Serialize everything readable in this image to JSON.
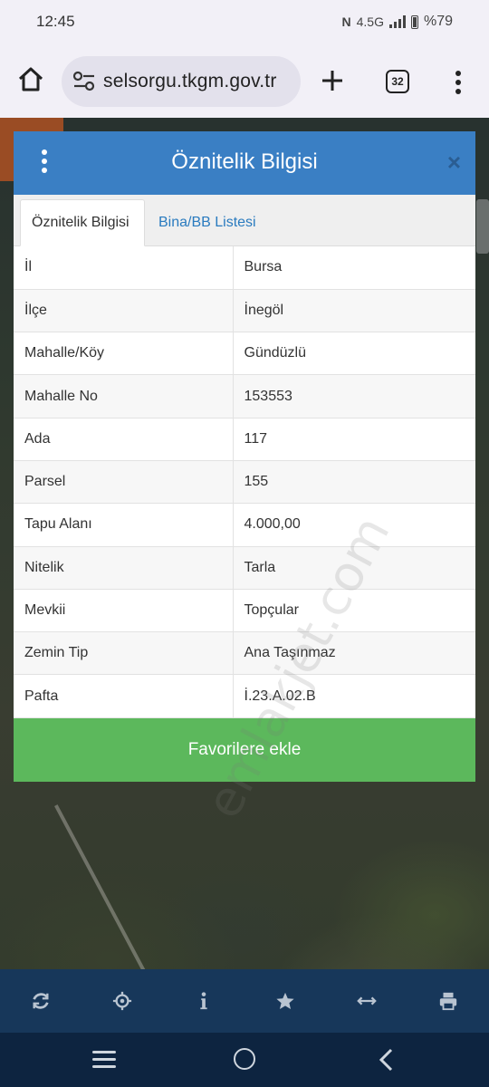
{
  "status_bar": {
    "time": "12:45",
    "network": "4.5G",
    "battery": "%79"
  },
  "browser": {
    "url": "selsorgu.tkgm.gov.tr",
    "tab_count": "32"
  },
  "dialog": {
    "title": "Öznitelik Bilgisi",
    "close_label": "×",
    "tabs": [
      {
        "label": "Öznitelik Bilgisi",
        "active": true
      },
      {
        "label": "Bina/BB Listesi",
        "active": false
      }
    ],
    "rows": [
      {
        "key": "İl",
        "value": "Bursa"
      },
      {
        "key": "İlçe",
        "value": "İnegöl"
      },
      {
        "key": "Mahalle/Köy",
        "value": "Gündüzlü"
      },
      {
        "key": "Mahalle No",
        "value": "153553"
      },
      {
        "key": "Ada",
        "value": "117"
      },
      {
        "key": "Parsel",
        "value": "155"
      },
      {
        "key": "Tapu Alanı",
        "value": "4.000,00"
      },
      {
        "key": "Nitelik",
        "value": "Tarla"
      },
      {
        "key": "Mevkii",
        "value": "Topçular"
      },
      {
        "key": "Zemin Tip",
        "value": "Ana Taşınmaz"
      },
      {
        "key": "Pafta",
        "value": "İ.23.A.02.B"
      }
    ],
    "favorite_label": "Favorilere ekle"
  },
  "watermark": "emlakjet.com",
  "toolbar": {
    "icons": [
      "refresh-icon",
      "locate-icon",
      "info-icon",
      "star-icon",
      "measure-icon",
      "print-icon"
    ]
  },
  "colors": {
    "header_blue": "#3a7fc4",
    "tab_link": "#2a7bbf",
    "favorite_green": "#5cb85c",
    "toolbar_navy": "#17375a"
  }
}
